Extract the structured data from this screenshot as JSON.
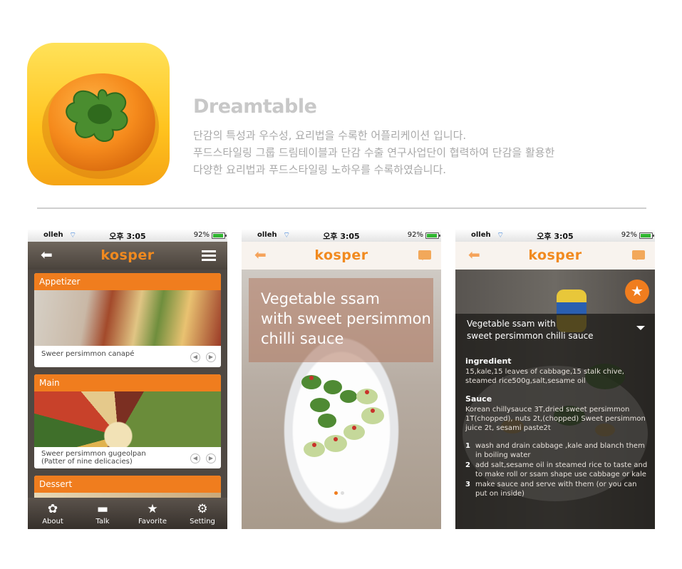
{
  "app": {
    "name": "Dreamtable",
    "description": [
      "단감의 특성과 우수성, 요리법을 수록한 어플리케이션 입니다.",
      "푸드스타일링 그룹 드림테이블과 단감 수출 연구사업단이 협력하여 단감을 활용한",
      "다양한 요리법과 푸드스타일링 노하우를 수록하였습니다."
    ]
  },
  "status_bar": {
    "carrier": "olleh",
    "time": "오후 3:05",
    "battery": "92%"
  },
  "logo": "kosper",
  "screen1": {
    "cards": [
      {
        "category": "Appetizer",
        "caption": "Sweer persimmon canapé"
      },
      {
        "category": "Main",
        "caption_line1": "Sweer persimmon gugeolpan",
        "caption_line2": "(Patter of nine delicacies)"
      },
      {
        "category": "Dessert"
      }
    ],
    "tabs": [
      {
        "label": "About",
        "icon": "about-icon"
      },
      {
        "label": "Talk",
        "icon": "talk-icon"
      },
      {
        "label": "Favorite",
        "icon": "favorite-star-icon"
      },
      {
        "label": "Setting",
        "icon": "gear-icon"
      }
    ]
  },
  "screen2": {
    "title_line1": "Vegetable ssam",
    "title_line2": "with sweet persimmon",
    "title_line3": "chilli sauce",
    "page_count": 2,
    "active_page": 1
  },
  "screen3": {
    "title_line1": "Vegetable ssam with",
    "title_line2": "sweet persimmon chilli sauce",
    "ingredient_heading": "ingredient",
    "ingredient_text": "15,kale,15 leaves of cabbage,15 stalk chive, steamed rice500g,salt,sesame oil",
    "sauce_heading": "Sauce",
    "sauce_text": "Korean chillysauce 3T,dried sweet persimmon 1T(chopped), nuts 2t,(chopped) Sweet persimmon juice 2t, sesami paste2t",
    "steps": [
      {
        "num": "1",
        "text": "wash and drain cabbage ,kale and blanch them in boiling water"
      },
      {
        "num": "2",
        "text": "add salt,sesame oil in steamed rice to taste and to make roll or ssam shape use cabbage or kale"
      },
      {
        "num": "3",
        "text": "make sauce and serve with them (or you can put on inside)"
      }
    ]
  },
  "colors": {
    "accent": "#f07d1e",
    "dark_nav": "#4a433c",
    "light_nav": "#f8f3ee"
  }
}
